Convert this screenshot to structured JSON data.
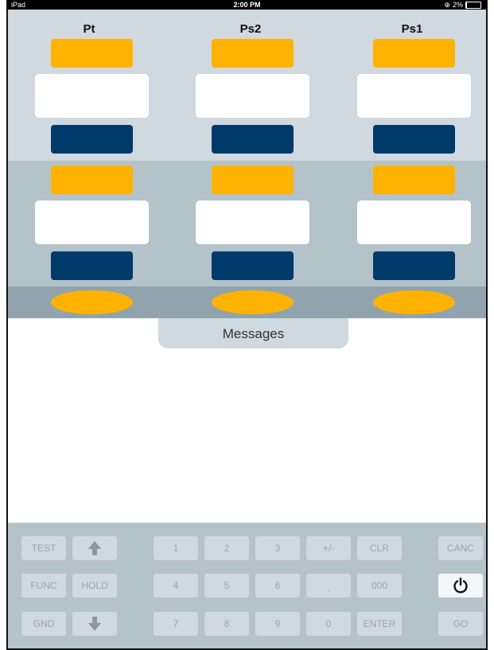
{
  "statusbar": {
    "device": "iPad",
    "time": "2:00 PM",
    "battery": "2%"
  },
  "columns": [
    {
      "title": "Pt"
    },
    {
      "title": "Ps2"
    },
    {
      "title": "Ps1"
    }
  ],
  "messages": {
    "label": "Messages"
  },
  "keypad": {
    "test": "TEST",
    "func": "FUNC",
    "hold": "HOLD",
    "gnd": "GND",
    "k1": "1",
    "k2": "2",
    "k3": "3",
    "plusminus": "+/-",
    "clr": "CLR",
    "canc": "CANC",
    "k4": "4",
    "k5": "5",
    "k6": "6",
    "dot": ".",
    "k000": "000",
    "k7": "7",
    "k8": "8",
    "k9": "9",
    "k0": "0",
    "enter": "ENTER",
    "go": "GO"
  },
  "colors": {
    "orange": "#ffb300",
    "navy": "#003a6b",
    "panel_light": "#d0d9df",
    "panel_mid": "#b4c2ca",
    "panel_dark": "#91a4ae"
  }
}
